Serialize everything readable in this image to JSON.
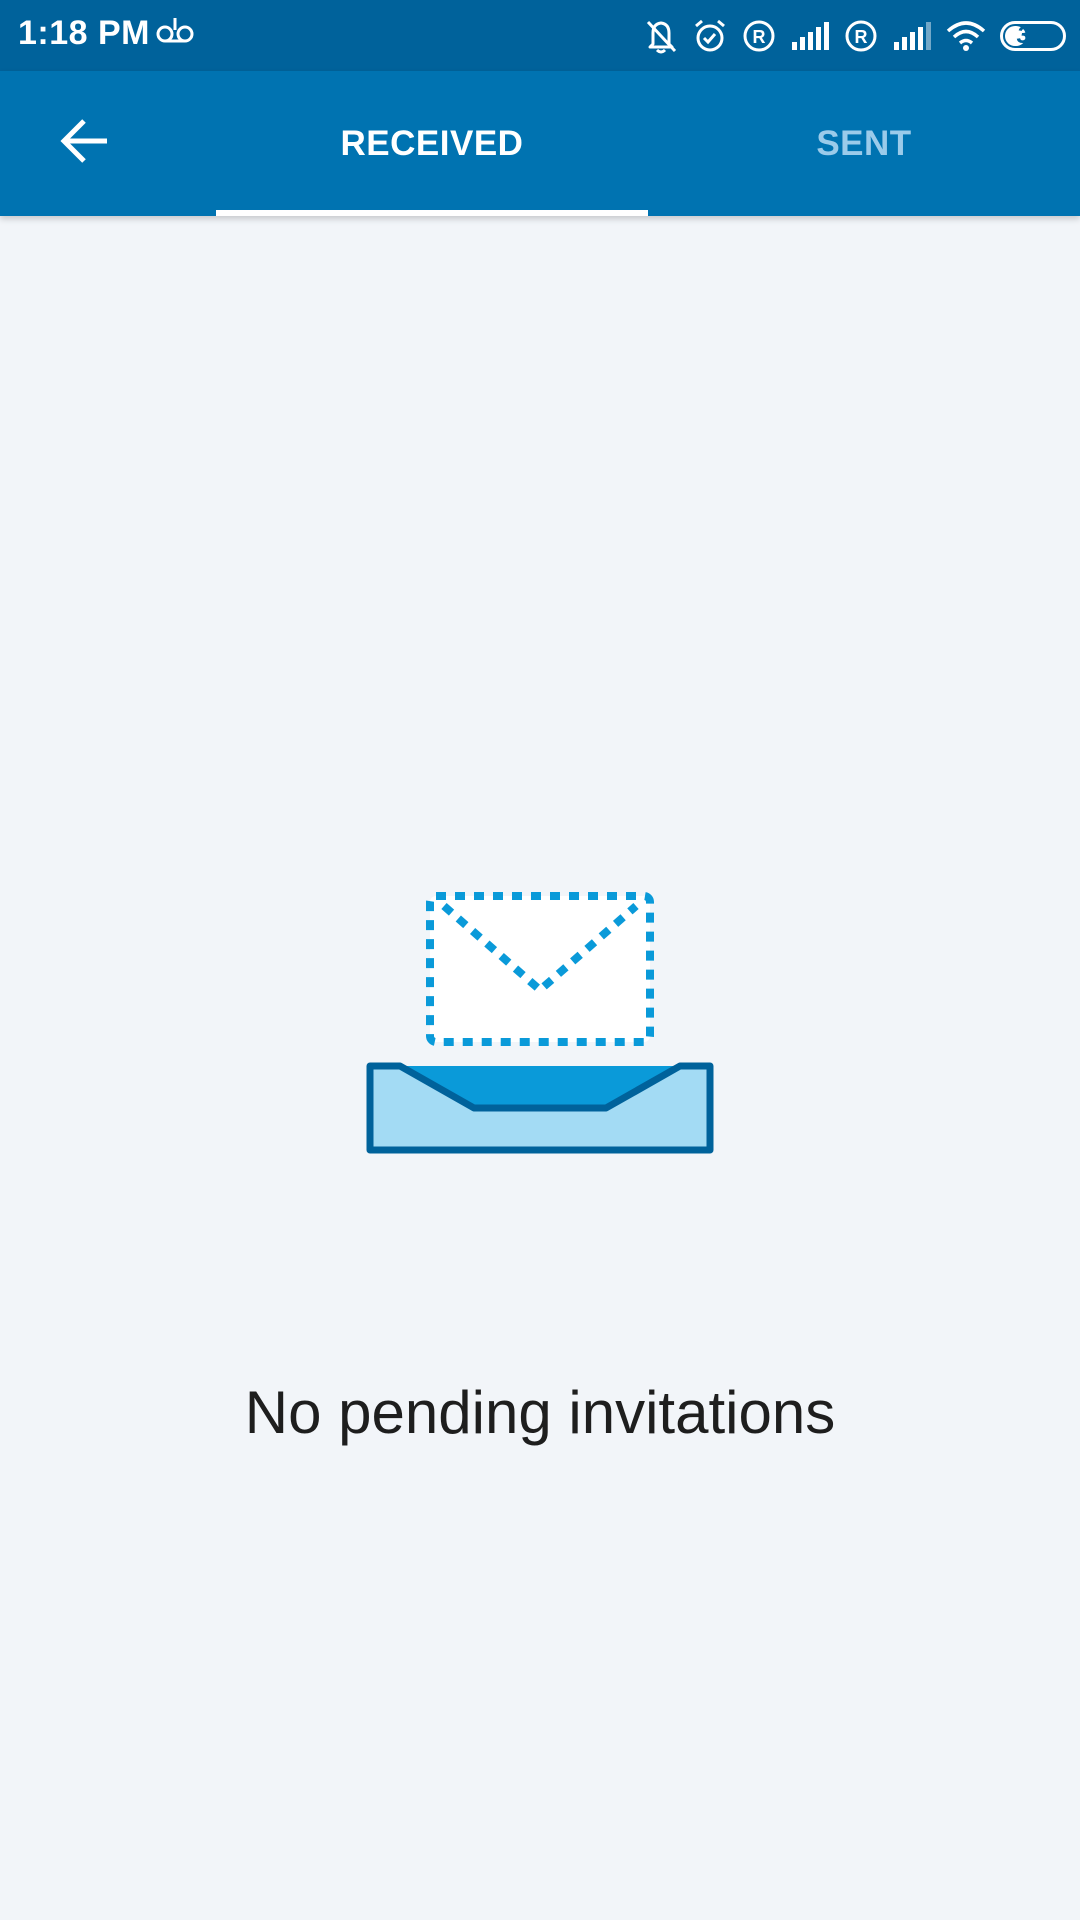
{
  "status_bar": {
    "time": "1:18 PM",
    "battery_level": "37",
    "battery_fraction": 0.37,
    "icons": [
      "voicemail-icon",
      "bell-off-icon",
      "alarm-icon",
      "roaming-icon",
      "signal-icon",
      "roaming-icon",
      "signal-icon",
      "wifi-icon",
      "battery-icon"
    ]
  },
  "app_bar": {
    "back_icon": "arrow-left-icon",
    "tabs": [
      {
        "label": "RECEIVED",
        "selected": true
      },
      {
        "label": "SENT",
        "selected": false
      }
    ]
  },
  "empty_state": {
    "icon": "envelope-inbox-icon",
    "message": "No pending invitations"
  },
  "colors": {
    "status_bar": "#00629b",
    "app_bar": "#0073b1",
    "tab_inactive": "#9bcbea",
    "background": "#f2f5f9",
    "illustration_dark": "#00629b",
    "illustration_mid": "#0a9ad9",
    "illustration_light": "#a3dbf4"
  }
}
